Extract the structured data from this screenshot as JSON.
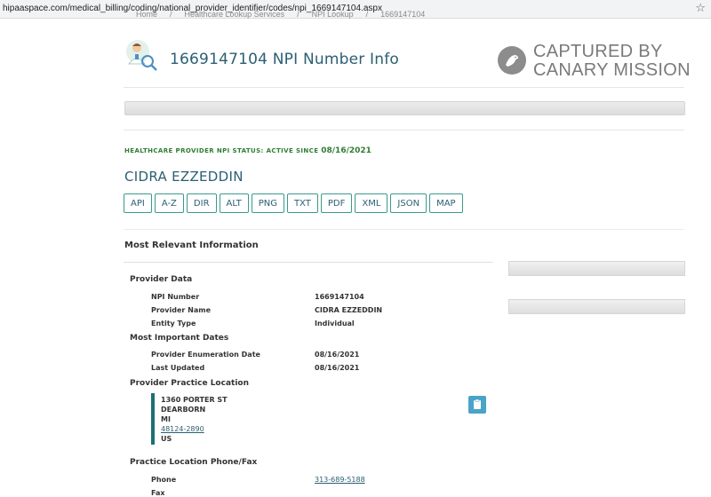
{
  "browser": {
    "url": "hipaaspace.com/medical_billing/coding/national_provider_identifier/codes/npi_1669147104.aspx"
  },
  "breadcrumb": [
    "Home",
    "Healthcare Lookup Services",
    "NPI Lookup",
    "1669147104"
  ],
  "header": {
    "title": "1669147104 NPI Number Info"
  },
  "watermark": {
    "line1": "CAPTURED BY",
    "line2": "CANARY MISSION"
  },
  "status": {
    "label": "HEALTHCARE PROVIDER NPI STATUS:",
    "state": "ACTIVE SINCE",
    "date": "08/16/2021"
  },
  "provider_name": "CIDRA EZZEDDIN",
  "format_buttons": [
    "API",
    "A-Z",
    "DIR",
    "ALT",
    "PNG",
    "TXT",
    "PDF",
    "XML",
    "JSON",
    "MAP"
  ],
  "section_title": "Most Relevant Information",
  "provider_data": {
    "heading": "Provider Data",
    "rows": [
      {
        "label": "NPI Number",
        "value": "1669147104"
      },
      {
        "label": "Provider Name",
        "value": "CIDRA EZZEDDIN"
      },
      {
        "label": "Entity Type",
        "value": "Individual"
      }
    ]
  },
  "dates": {
    "heading": "Most Important Dates",
    "rows": [
      {
        "label": "Provider Enumeration Date",
        "value": "08/16/2021"
      },
      {
        "label": "Last Updated",
        "value": "08/16/2021"
      }
    ]
  },
  "practice_location": {
    "heading": "Provider Practice Location",
    "street": "1360 PORTER ST",
    "city": "DEARBORN",
    "state": "MI",
    "zip": "48124-2890",
    "country": "US"
  },
  "phone_fax": {
    "heading": "Practice Location Phone/Fax",
    "phone_label": "Phone",
    "phone": "313-689-5188",
    "fax_label": "Fax"
  },
  "icons": {
    "doctor": "doctor-magnifier-icon",
    "canary": "canary-bird-icon",
    "clipboard": "clipboard-icon",
    "star": "bookmark-star-icon"
  },
  "colors": {
    "title": "#2b5f73",
    "status_green": "#2e7d32",
    "button_border": "#3a9a8c",
    "address_bar": "#1f6f74",
    "clipboard_bg": "#4aa3c9"
  }
}
